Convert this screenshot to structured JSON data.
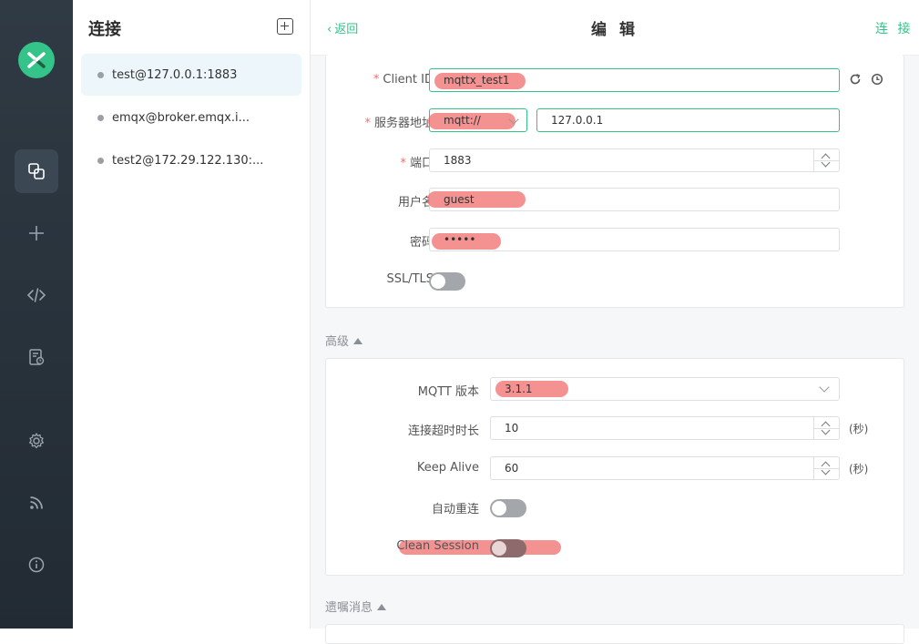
{
  "rail": {
    "items": [
      {
        "icon": "connections-icon",
        "active": true
      },
      {
        "icon": "plus-icon"
      },
      {
        "icon": "code-icon"
      },
      {
        "icon": "log-icon"
      },
      {
        "icon": "gear-icon"
      },
      {
        "icon": "rss-icon"
      },
      {
        "icon": "info-icon"
      }
    ],
    "logo": "mqttx-logo",
    "accent": "#34c388"
  },
  "connections": {
    "title": "连接",
    "items": [
      {
        "name": "test@127.0.0.1:1883",
        "active": true
      },
      {
        "name": "emqx@broker.emqx.i..."
      },
      {
        "name": "test2@172.29.122.130:..."
      }
    ]
  },
  "topbar": {
    "back": "返回",
    "title": "编 辑",
    "connect": "连 接"
  },
  "general": {
    "client_id": {
      "label": "Client ID",
      "value": "mqttx_test1"
    },
    "server": {
      "label": "服务器地址",
      "protocol": "mqtt://",
      "host": "127.0.0.1"
    },
    "port": {
      "label": "端口",
      "value": "1883"
    },
    "username": {
      "label": "用户名",
      "value": "guest"
    },
    "password": {
      "label": "密码",
      "value": "•••••"
    },
    "ssl": {
      "label": "SSL/TLS",
      "enabled": false
    }
  },
  "advanced": {
    "section": "高级",
    "mqtt_version": {
      "label": "MQTT 版本",
      "value": "3.1.1"
    },
    "connect_timeout": {
      "label": "连接超时时长",
      "value": "10",
      "unit": "(秒)"
    },
    "keep_alive": {
      "label": "Keep Alive",
      "value": "60",
      "unit": "(秒)"
    },
    "auto_reconnect": {
      "label": "自动重连",
      "enabled": false
    },
    "clean_session": {
      "label": "Clean Session",
      "enabled": false
    }
  },
  "will": {
    "section": "遗嘱消息"
  }
}
